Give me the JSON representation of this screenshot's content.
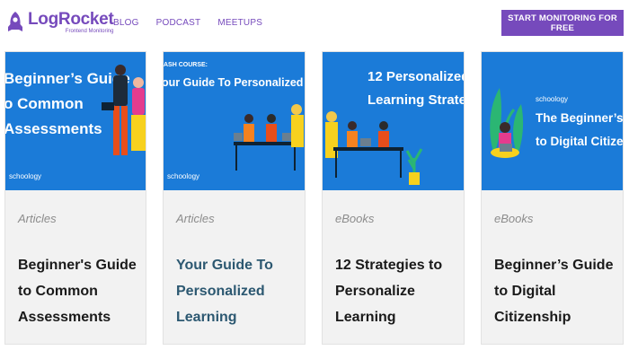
{
  "brand": {
    "name": "LogRocket",
    "tagline": "Frontend Monitoring",
    "color": "#764abc"
  },
  "nav": {
    "items": [
      {
        "label": "BLOG"
      },
      {
        "label": "PODCAST"
      },
      {
        "label": "MEETUPS"
      }
    ]
  },
  "cta": {
    "label": "START MONITORING FOR FREE"
  },
  "cards": [
    {
      "image_heading": [
        "Beginner’s Guide",
        "o Common",
        "Assessments"
      ],
      "image_brand": "schoology",
      "category": "Articles",
      "title": "Beginner's Guide to Common Assessments"
    },
    {
      "image_kicker": "ASH COURSE:",
      "image_heading": [
        "our Guide To Personalized Learning"
      ],
      "image_brand": "schoology",
      "category": "Articles",
      "title": "Your Guide To Personalized Learning"
    },
    {
      "image_heading": [
        "12 Personalized",
        "Learning Strategie"
      ],
      "category": "eBooks",
      "title": "12 Strategies to Personalize Learning"
    },
    {
      "image_brand": "schoology",
      "image_heading": [
        "The Beginner’s Guid",
        "to Digital Citizenshy"
      ],
      "category": "eBooks",
      "title": "Beginner’s Guide to Digital Citizenship"
    }
  ],
  "colors": {
    "image_background": "#1b7bd8",
    "card_background": "#f2f2f2",
    "highlight_title": "#2c5871"
  }
}
